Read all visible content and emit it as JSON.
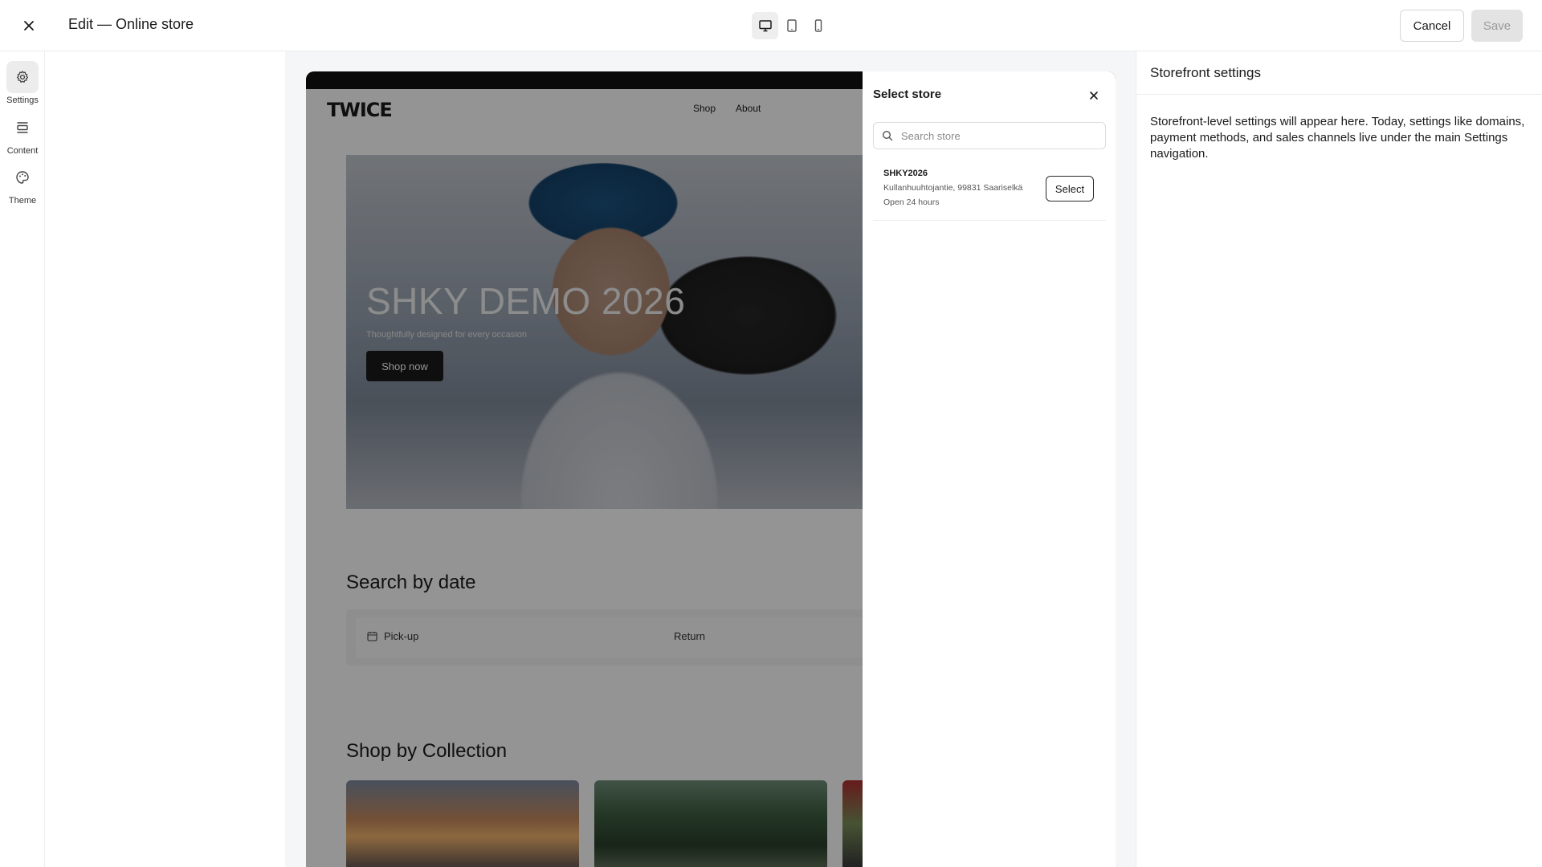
{
  "topbar": {
    "title": "Edit — Online store",
    "cancel_label": "Cancel",
    "save_label": "Save"
  },
  "sidebar": {
    "items": [
      {
        "label": "Settings",
        "icon": "gear-icon",
        "active": true
      },
      {
        "label": "Content",
        "icon": "sections-icon",
        "active": false
      },
      {
        "label": "Theme",
        "icon": "palette-icon",
        "active": false
      }
    ]
  },
  "preview": {
    "logo": "TWICE",
    "nav": [
      "Shop",
      "About"
    ],
    "hero": {
      "title": "SHKY DEMO 2026",
      "subtitle": "Thoughtfully designed for every occasion",
      "button": "Shop now"
    },
    "date_section": {
      "title": "Search by date",
      "pickup_label": "Pick-up",
      "return_label": "Return"
    },
    "collection_section": {
      "title": "Shop by Collection"
    }
  },
  "drawer": {
    "title": "Select store",
    "search_placeholder": "Search store",
    "stores": [
      {
        "name": "SHKY2026",
        "address": "Kullanhuuhtojantie, 99831 Saariselkä",
        "hours": "Open 24 hours",
        "button": "Select"
      }
    ]
  },
  "right_panel": {
    "title": "Storefront settings",
    "description": "Storefront-level settings will appear here. Today, settings like domains, payment methods, and sales channels live under the main Settings navigation."
  },
  "colors": {
    "accent_dark": "#1a1a1a",
    "border": "#ececec",
    "canvas_bg": "#f5f6f7",
    "save_disabled": "#e3e3e3"
  }
}
